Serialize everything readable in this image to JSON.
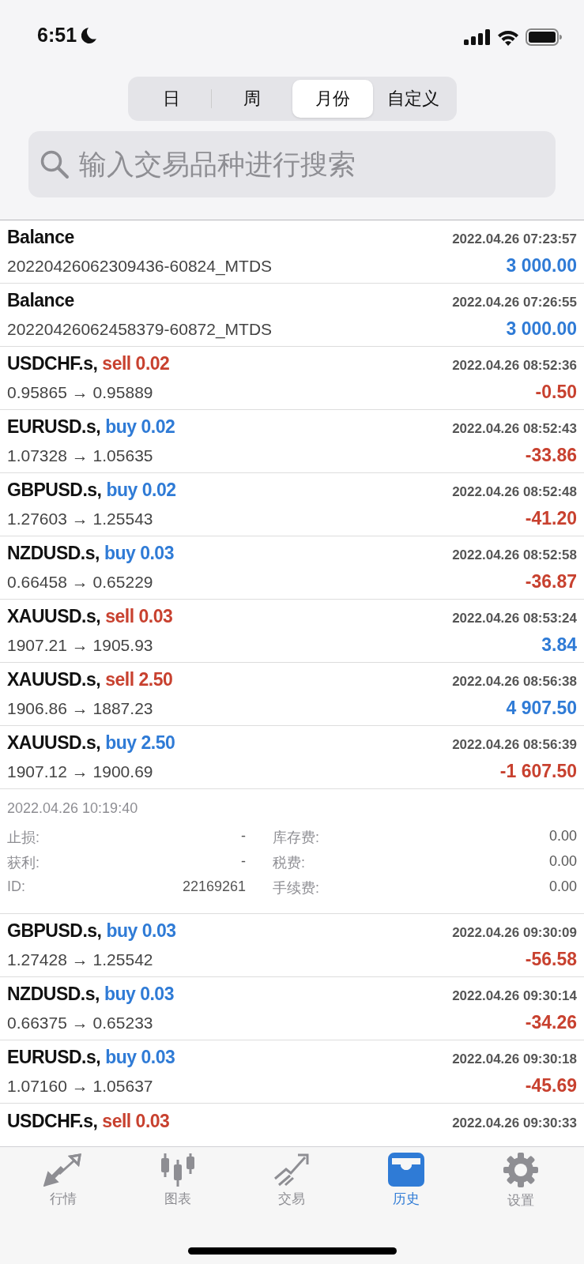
{
  "status_bar": {
    "time": "6:51"
  },
  "period_tabs": [
    {
      "label": "日",
      "selected": false
    },
    {
      "label": "周",
      "selected": false
    },
    {
      "label": "月份",
      "selected": true
    },
    {
      "label": "自定义",
      "selected": false
    }
  ],
  "search": {
    "placeholder": "输入交易品种进行搜索"
  },
  "history": [
    {
      "kind": "balance",
      "title": "Balance",
      "time": "2022.04.26 07:23:57",
      "comment": "20220426062309436-60824_MTDS",
      "amount": {
        "text": "3 000.00",
        "color": "#2f7bd6"
      }
    },
    {
      "kind": "balance",
      "title": "Balance",
      "time": "2022.04.26 07:26:55",
      "comment": "20220426062458379-60872_MTDS",
      "amount": {
        "text": "3 000.00",
        "color": "#2f7bd6"
      }
    },
    {
      "kind": "trade",
      "title": "USDCHF.s,",
      "side": {
        "text": "sell 0.02",
        "color": "#c8412f"
      },
      "time": "2022.04.26 08:52:36",
      "prices": "0.95865 → 0.95889",
      "amount": {
        "text": "-0.50",
        "color": "#c8412f"
      }
    },
    {
      "kind": "trade",
      "title": "EURUSD.s,",
      "side": {
        "text": "buy 0.02",
        "color": "#2f7bd6"
      },
      "time": "2022.04.26 08:52:43",
      "prices": "1.07328 → 1.05635",
      "amount": {
        "text": "-33.86",
        "color": "#c8412f"
      }
    },
    {
      "kind": "trade",
      "title": "GBPUSD.s,",
      "side": {
        "text": "buy 0.02",
        "color": "#2f7bd6"
      },
      "time": "2022.04.26 08:52:48",
      "prices": "1.27603 → 1.25543",
      "amount": {
        "text": "-41.20",
        "color": "#c8412f"
      }
    },
    {
      "kind": "trade",
      "title": "NZDUSD.s,",
      "side": {
        "text": "buy 0.03",
        "color": "#2f7bd6"
      },
      "time": "2022.04.26 08:52:58",
      "prices": "0.66458 → 0.65229",
      "amount": {
        "text": "-36.87",
        "color": "#c8412f"
      }
    },
    {
      "kind": "trade",
      "title": "XAUUSD.s,",
      "side": {
        "text": "sell 0.03",
        "color": "#c8412f"
      },
      "time": "2022.04.26 08:53:24",
      "prices": "1907.21 → 1905.93",
      "amount": {
        "text": "3.84",
        "color": "#2f7bd6"
      }
    },
    {
      "kind": "trade",
      "title": "XAUUSD.s,",
      "side": {
        "text": "sell 2.50",
        "color": "#c8412f"
      },
      "time": "2022.04.26 08:56:38",
      "prices": "1906.86 → 1887.23",
      "amount": {
        "text": "4 907.50",
        "color": "#2f7bd6"
      }
    },
    {
      "kind": "trade",
      "title": "XAUUSD.s,",
      "side": {
        "text": "buy 2.50",
        "color": "#2f7bd6"
      },
      "time": "2022.04.26 08:56:39",
      "prices": "1907.12 → 1900.69",
      "amount": {
        "text": "-1 607.50",
        "color": "#c8412f"
      },
      "details": {
        "close_time": "2022.04.26 10:19:40",
        "rows": [
          {
            "left": {
              "label": "止损:",
              "value": "-"
            },
            "right": {
              "label": "库存费:",
              "value": "0.00"
            }
          },
          {
            "left": {
              "label": "获利:",
              "value": "-"
            },
            "right": {
              "label": "税费:",
              "value": "0.00"
            }
          },
          {
            "left": {
              "label": "ID:",
              "value": "22169261"
            },
            "right": {
              "label": "手续费:",
              "value": "0.00"
            }
          }
        ]
      }
    },
    {
      "kind": "trade",
      "title": "GBPUSD.s,",
      "side": {
        "text": "buy 0.03",
        "color": "#2f7bd6"
      },
      "time": "2022.04.26 09:30:09",
      "prices": "1.27428 → 1.25542",
      "amount": {
        "text": "-56.58",
        "color": "#c8412f"
      }
    },
    {
      "kind": "trade",
      "title": "NZDUSD.s,",
      "side": {
        "text": "buy 0.03",
        "color": "#2f7bd6"
      },
      "time": "2022.04.26 09:30:14",
      "prices": "0.66375 → 0.65233",
      "amount": {
        "text": "-34.26",
        "color": "#c8412f"
      }
    },
    {
      "kind": "trade",
      "title": "EURUSD.s,",
      "side": {
        "text": "buy 0.03",
        "color": "#2f7bd6"
      },
      "time": "2022.04.26 09:30:18",
      "prices": "1.07160 → 1.05637",
      "amount": {
        "text": "-45.69",
        "color": "#c8412f"
      }
    },
    {
      "kind": "trade",
      "title": "USDCHF.s,",
      "side": {
        "text": "sell 0.03",
        "color": "#c8412f"
      },
      "time": "2022.04.26 09:30:33"
    }
  ],
  "tab_bar": [
    {
      "kind": "quotes",
      "label": "行情",
      "selected": false
    },
    {
      "kind": "chart",
      "label": "图表",
      "selected": false
    },
    {
      "kind": "trade",
      "label": "交易",
      "selected": false
    },
    {
      "kind": "history",
      "label": "历史",
      "selected": true
    },
    {
      "kind": "settings",
      "label": "设置",
      "selected": false
    }
  ]
}
